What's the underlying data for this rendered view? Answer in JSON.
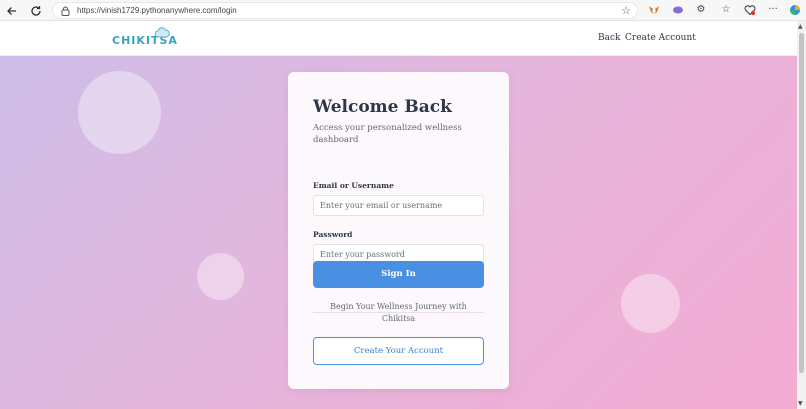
{
  "browser": {
    "url": "https://vinish1729.pythonanywhere.com/login",
    "nav_icons": [
      "back-arrow-icon",
      "reload-icon"
    ],
    "extension_icons": [
      "metamask-icon",
      "extension-icon",
      "puzzle-icon",
      "favorites-icon",
      "shopping-icon",
      "more-icon",
      "copilot-icon"
    ]
  },
  "header": {
    "logo_text": "CHIKITSA",
    "back_label": "Back",
    "create_account_label": "Create Account"
  },
  "login": {
    "title": "Welcome Back",
    "subtitle": "Access your personalized wellness dashboard",
    "email_label": "Email or Username",
    "email_placeholder": "Enter your email or username",
    "password_label": "Password",
    "password_placeholder": "Enter your password",
    "signin_label": "Sign In",
    "divider_text": "Begin Your Wellness Journey with Chikitsa",
    "create_label": "Create Your Account"
  },
  "colors": {
    "primary": "#4a90e2",
    "heading": "#2d3748",
    "gradient_start": "#cdbde8",
    "gradient_end": "#f4abd3"
  }
}
